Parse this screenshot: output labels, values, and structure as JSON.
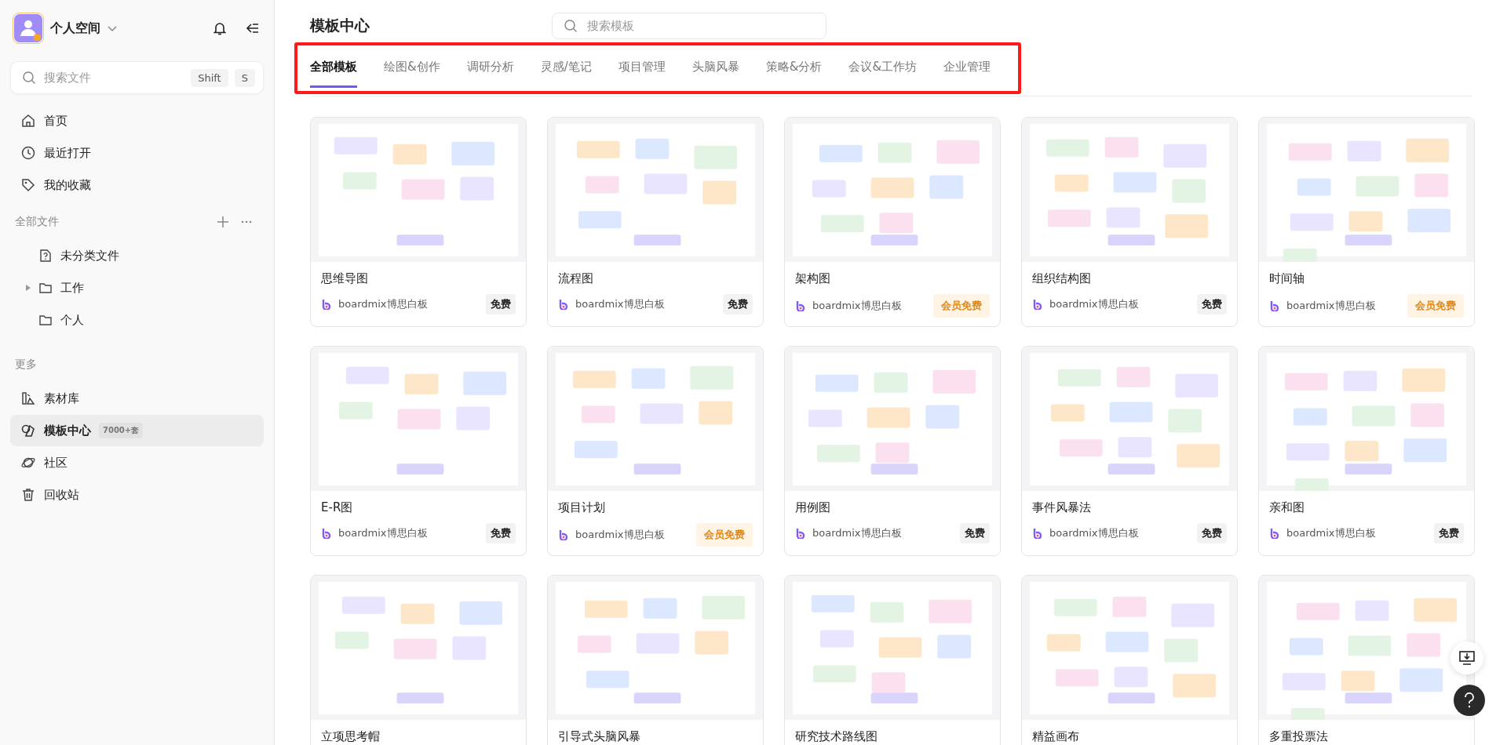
{
  "sidebar": {
    "workspace": "个人空间",
    "search": {
      "placeholder": "搜索文件",
      "keys": [
        "Shift",
        "S"
      ]
    },
    "nav": [
      {
        "label": "首页",
        "selected": false
      },
      {
        "label": "最近打开",
        "selected": false
      },
      {
        "label": "我的收藏",
        "selected": false
      }
    ],
    "files_section": "全部文件",
    "files": [
      {
        "label": "未分类文件",
        "expandable": false
      },
      {
        "label": "工作",
        "expandable": true
      },
      {
        "label": "个人",
        "expandable": false
      }
    ],
    "more_section": "更多",
    "more": [
      {
        "label": "素材库",
        "selected": false
      },
      {
        "label": "模板中心",
        "selected": true,
        "badge": "7000+套"
      },
      {
        "label": "社区",
        "selected": false
      },
      {
        "label": "回收站",
        "selected": false
      }
    ]
  },
  "header": {
    "title": "模板中心",
    "search": {
      "placeholder": "搜索模板"
    }
  },
  "tabs": [
    {
      "label": "全部模板",
      "selected": true
    },
    {
      "label": "绘图&创作",
      "selected": false
    },
    {
      "label": "调研分析",
      "selected": false
    },
    {
      "label": "灵感/笔记",
      "selected": false
    },
    {
      "label": "项目管理",
      "selected": false
    },
    {
      "label": "头脑风暴",
      "selected": false
    },
    {
      "label": "策略&分析",
      "selected": false
    },
    {
      "label": "会议&工作坊",
      "selected": false
    },
    {
      "label": "企业管理",
      "selected": false
    }
  ],
  "templates": [
    {
      "title": "思维导图",
      "source": "boardmix博思白板",
      "price": "免费",
      "kind": "free"
    },
    {
      "title": "流程图",
      "source": "boardmix博思白板",
      "price": "免费",
      "kind": "free"
    },
    {
      "title": "架构图",
      "source": "boardmix博思白板",
      "price": "会员免费",
      "kind": "member"
    },
    {
      "title": "组织结构图",
      "source": "boardmix博思白板",
      "price": "免费",
      "kind": "free"
    },
    {
      "title": "时间轴",
      "source": "boardmix博思白板",
      "price": "会员免费",
      "kind": "member"
    },
    {
      "title": "E-R图",
      "source": "boardmix博思白板",
      "price": "免费",
      "kind": "free"
    },
    {
      "title": "项目计划",
      "source": "boardmix博思白板",
      "price": "会员免费",
      "kind": "member"
    },
    {
      "title": "用例图",
      "source": "boardmix博思白板",
      "price": "免费",
      "kind": "free"
    },
    {
      "title": "事件风暴法",
      "source": "boardmix博思白板",
      "price": "免费",
      "kind": "free"
    },
    {
      "title": "亲和图",
      "source": "boardmix博思白板",
      "price": "免费",
      "kind": "free"
    },
    {
      "title": "立项思考帽"
    },
    {
      "title": "引导式头脑风暴"
    },
    {
      "title": "研究技术路线图"
    },
    {
      "title": "精益画布"
    },
    {
      "title": "多重投票法"
    }
  ]
}
